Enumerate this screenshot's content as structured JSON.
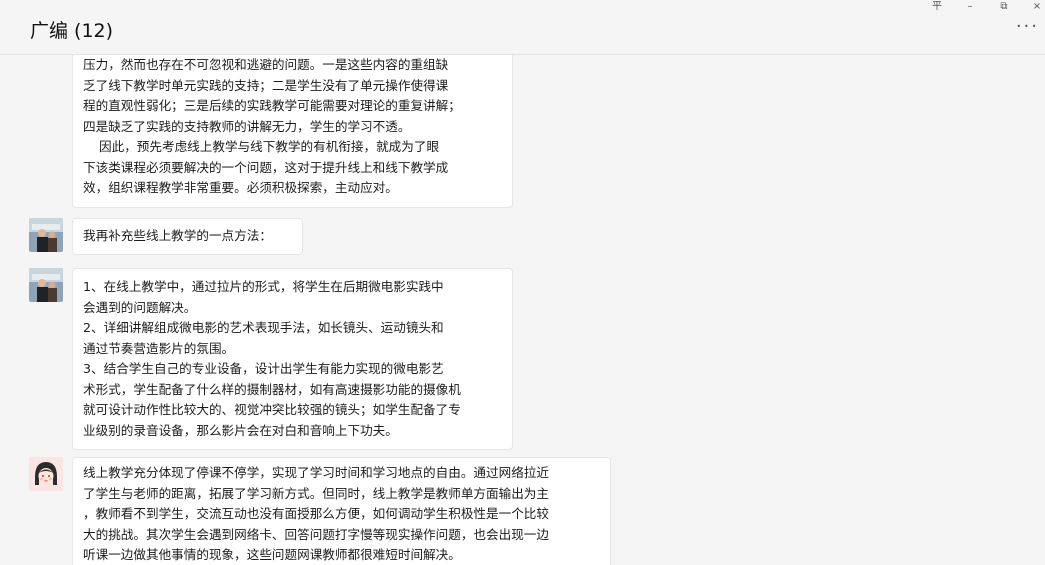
{
  "header": {
    "title": "广编 (12)",
    "pin_label": "平",
    "minimize_label": "–",
    "restore_label": "⧉",
    "close_label": "×",
    "more_label": "···"
  },
  "messages": [
    {
      "sender": "continued",
      "lines": [
        "压力，然而也存在不可忽视和逃避的问题。一是这些内容的重组缺",
        "乏了线下教学时单元实践的支持；二是学生没有了单元操作使得课",
        "程的直观性弱化；三是后续的实践教学可能需要对理论的重复讲解；",
        "四是缺乏了实践的支持教师的讲解无力，学生的学习不透。",
        "    因此，预先考虑线上教学与线下教学的有机衔接，就成为了眼",
        "下该类课程必须要解决的一个问题，这对于提升线上和线下教学成",
        "效，组织课程教学非常重要。必须积极探索，主动应对。"
      ]
    },
    {
      "sender": "user-a",
      "lines": [
        "我再补充些线上教学的一点方法："
      ]
    },
    {
      "sender": "user-a",
      "lines": [
        "1、在线上教学中，通过拉片的形式，将学生在后期微电影实践中",
        "会遇到的问题解决。",
        "2、详细讲解组成微电影的艺术表现手法，如长镜头、运动镜头和",
        "通过节奏营造影片的氛围。",
        "3、结合学生自己的专业设备，设计出学生有能力实现的微电影艺",
        "术形式，学生配备了什么样的摄制器材，如有高速摄影功能的摄像机",
        "就可设计动作性比较大的、视觉冲突比较强的镜头；如学生配备了专",
        "业级别的录音设备，那么影片会在对白和音响上下功夫。"
      ]
    },
    {
      "sender": "user-b",
      "lines": [
        "线上教学充分体现了停课不停学，实现了学习时间和学习地点的自由。通过网络拉近",
        "了学生与老师的距离，拓展了学习新方式。但同时，线上教学是教师单方面输出为主",
        "，教师看不到学生，交流互动也没有面授那么方便，如何调动学生积极性是一个比较",
        "大的挑战。其次学生会遇到网络卡、回答问题打字慢等现实操作问题，也会出现一边",
        "听课一边做其他事情的现象，这些问题网课教师都很难短时间解决。"
      ]
    }
  ]
}
